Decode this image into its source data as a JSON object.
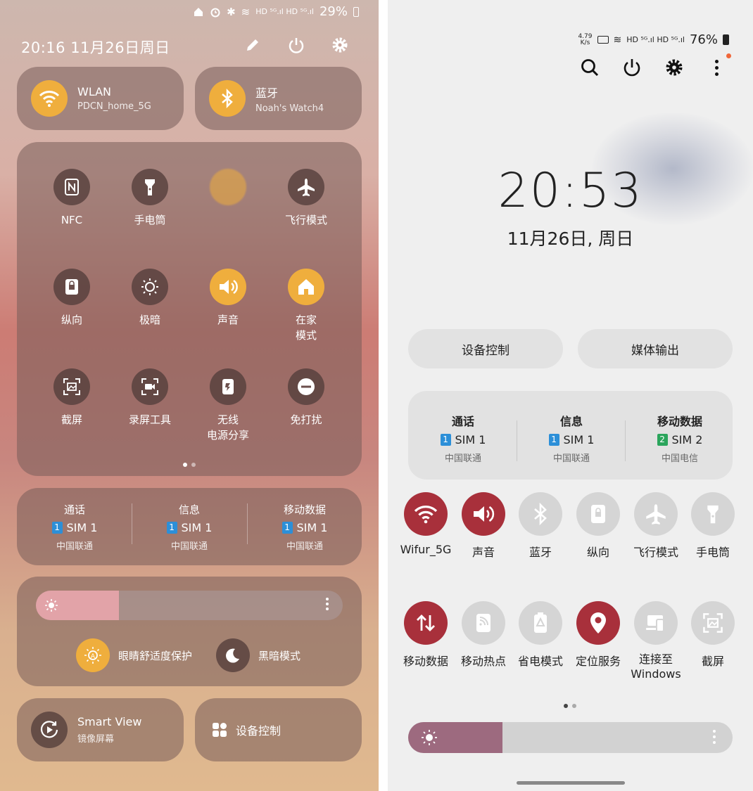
{
  "left": {
    "status_bar": {
      "text": "HD ⁵ᴳ.ıl HD ⁵ᴳ.ıl",
      "battery": "29%"
    },
    "datetime": "20:16  11月26日周日",
    "wlan": {
      "title": "WLAN",
      "subtitle": "PDCN_home_5G"
    },
    "bluetooth": {
      "title": "蓝牙",
      "subtitle": "Noah's Watch4"
    },
    "tiles": [
      {
        "label": "NFC",
        "state": "off",
        "icon": "nfc-icon"
      },
      {
        "label": "手电筒",
        "state": "off",
        "icon": "flashlight-icon"
      },
      {
        "label": "",
        "state": "on",
        "icon": "blurred-icon"
      },
      {
        "label": "飞行模式",
        "state": "off",
        "icon": "airplane-icon"
      },
      {
        "label": "纵向",
        "state": "off",
        "icon": "rotation-lock-icon"
      },
      {
        "label": "极暗",
        "state": "off",
        "icon": "extra-dim-icon"
      },
      {
        "label": "声音",
        "state": "on",
        "icon": "sound-icon"
      },
      {
        "label": "在家\n模式",
        "state": "on",
        "icon": "home-icon"
      },
      {
        "label": "截屏",
        "state": "off",
        "icon": "screenshot-icon"
      },
      {
        "label": "录屏工具",
        "state": "off",
        "icon": "screen-recorder-icon"
      },
      {
        "label": "无线\n电源分享",
        "state": "off",
        "icon": "wireless-powershare-icon"
      },
      {
        "label": "免打扰",
        "state": "off",
        "icon": "do-not-disturb-icon"
      }
    ],
    "sim": [
      {
        "header": "通话",
        "badge": "1",
        "sim": "SIM 1",
        "carrier": "中国联通"
      },
      {
        "header": "信息",
        "badge": "1",
        "sim": "SIM 1",
        "carrier": "中国联通"
      },
      {
        "header": "移动数据",
        "badge": "1",
        "sim": "SIM 1",
        "carrier": "中国联通"
      }
    ],
    "brightness_fraction": 0.27,
    "eye_comfort": "眼睛舒适度保护",
    "dark_mode": "黑暗模式",
    "smart_view": {
      "title": "Smart View",
      "subtitle": "镜像屏幕"
    },
    "device_control": "设备控制"
  },
  "right": {
    "status_bar": {
      "speed": "4.79\nK/s",
      "text": "HD ⁵ᴳ.ıl HD ⁵ᴳ.ıl",
      "battery": "76%"
    },
    "clock": "20:53",
    "date": "11月26日, 周日",
    "device_control": "设备控制",
    "media_output": "媒体输出",
    "sim": [
      {
        "header": "通话",
        "badge": "1",
        "sim": "SIM 1",
        "carrier": "中国联通"
      },
      {
        "header": "信息",
        "badge": "1",
        "sim": "SIM 1",
        "carrier": "中国联通"
      },
      {
        "header": "移动数据",
        "badge": "2",
        "sim": "SIM 2",
        "carrier": "中国电信"
      }
    ],
    "tiles_row1": [
      {
        "label": "Wifur_5G",
        "state": "on",
        "icon": "wifi-icon"
      },
      {
        "label": "声音",
        "state": "on",
        "icon": "sound-icon"
      },
      {
        "label": "蓝牙",
        "state": "off",
        "icon": "bluetooth-icon"
      },
      {
        "label": "纵向",
        "state": "off",
        "icon": "rotation-lock-icon"
      },
      {
        "label": "飞行模式",
        "state": "off",
        "icon": "airplane-icon"
      },
      {
        "label": "手电筒",
        "state": "off",
        "icon": "flashlight-icon"
      }
    ],
    "tiles_row2": [
      {
        "label": "移动数据",
        "state": "on",
        "icon": "mobile-data-icon"
      },
      {
        "label": "移动热点",
        "state": "off",
        "icon": "hotspot-icon"
      },
      {
        "label": "省电模式",
        "state": "off",
        "icon": "power-saving-icon"
      },
      {
        "label": "定位服务",
        "state": "on",
        "icon": "location-icon"
      },
      {
        "label": "连接至\nWindows",
        "state": "off",
        "icon": "link-to-windows-icon"
      },
      {
        "label": "截屏",
        "state": "off",
        "icon": "screenshot-icon"
      }
    ],
    "brightness_fraction": 0.29,
    "colors": {
      "accent_on": "#a8303b",
      "tile_off": "#d5d5d5",
      "brightness": "#9d6a7f"
    }
  },
  "left_colors": {
    "accent_on": "#efae3d",
    "brightness": "#e2a3a8"
  }
}
